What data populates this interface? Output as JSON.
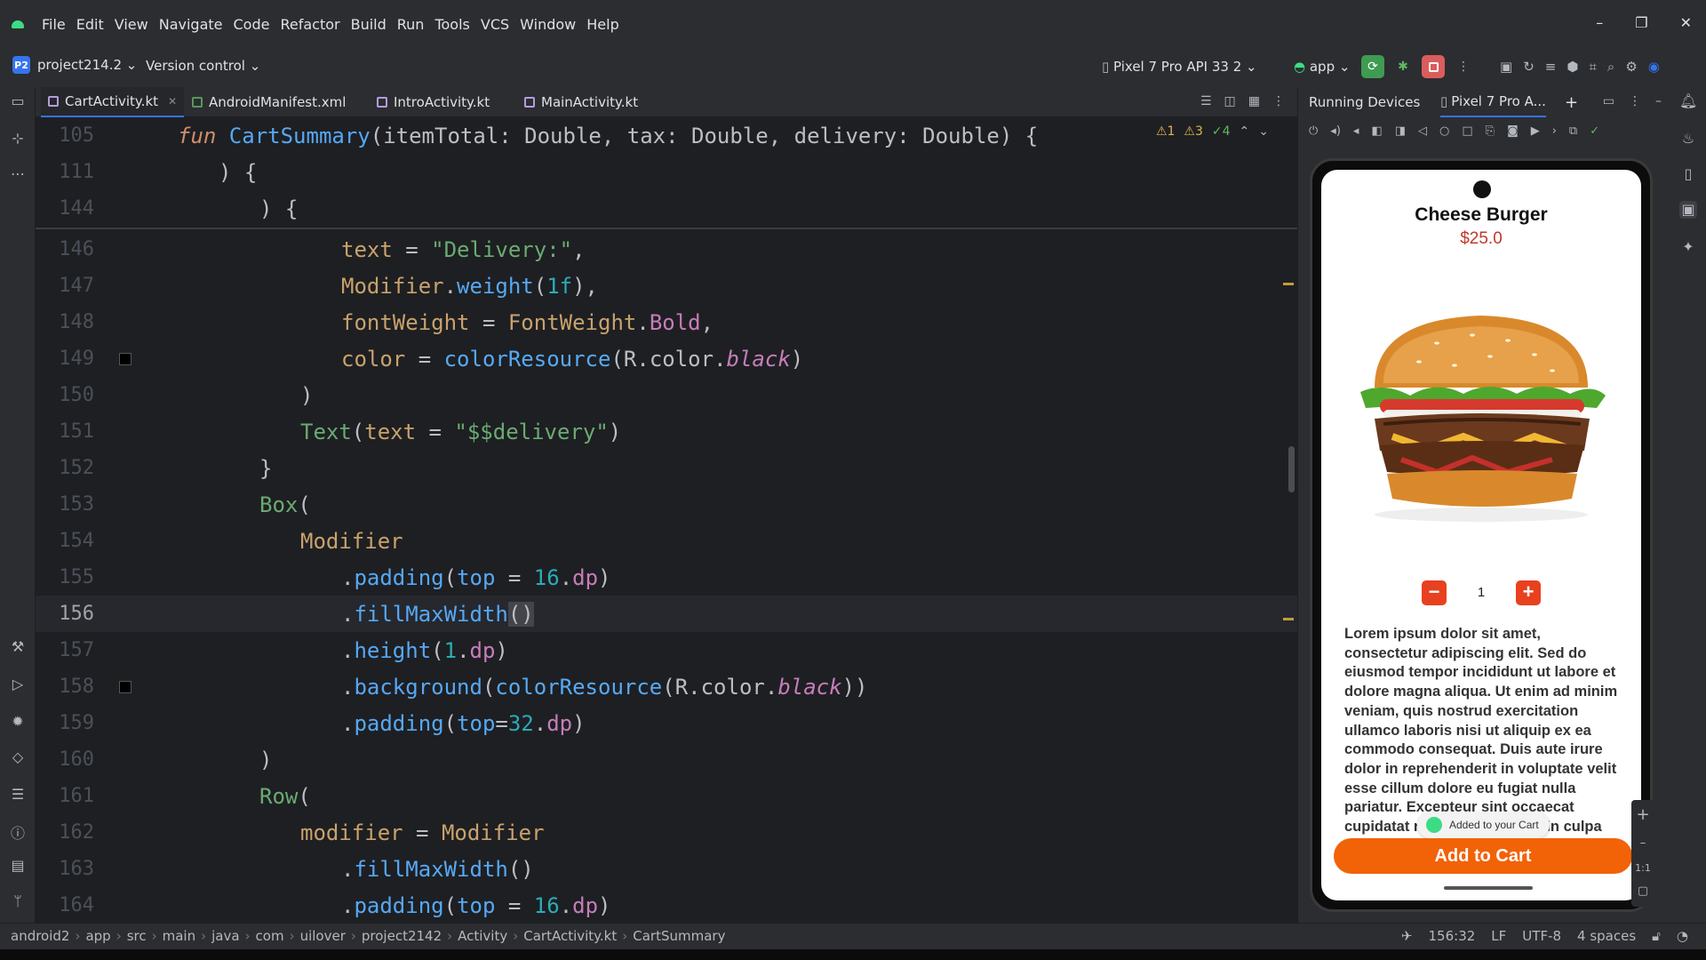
{
  "menubar": {
    "items": [
      "File",
      "Edit",
      "View",
      "Navigate",
      "Code",
      "Refactor",
      "Build",
      "Run",
      "Tools",
      "VCS",
      "Window",
      "Help"
    ],
    "minimize": "–",
    "maximize": "❐",
    "close": "✕"
  },
  "toolbar": {
    "project_badge": "P2",
    "project_name": "project214.2 ⌄",
    "version_control": "Version control ⌄",
    "device": "Pixel 7 Pro API 33 2 ⌄",
    "run_config": "app ⌄"
  },
  "tabs": [
    {
      "label": "CartActivity.kt",
      "close": "✕"
    },
    {
      "label": "AndroidManifest.xml"
    },
    {
      "label": "IntroActivity.kt"
    },
    {
      "label": "MainActivity.kt"
    }
  ],
  "editor_status": {
    "warn1": "⚠1",
    "warn2": "⚠3",
    "ok": "✓4"
  },
  "code": {
    "sticky": [
      {
        "num": "105"
      },
      {
        "num": "111"
      },
      {
        "num": "144"
      }
    ],
    "lines": [
      {
        "num": "146"
      },
      {
        "num": "147"
      },
      {
        "num": "148"
      },
      {
        "num": "149"
      },
      {
        "num": "150"
      },
      {
        "num": "151"
      },
      {
        "num": "152"
      },
      {
        "num": "153"
      },
      {
        "num": "154"
      },
      {
        "num": "155"
      },
      {
        "num": "156"
      },
      {
        "num": "157"
      },
      {
        "num": "158"
      },
      {
        "num": "159"
      },
      {
        "num": "160"
      },
      {
        "num": "161"
      },
      {
        "num": "162"
      },
      {
        "num": "163"
      },
      {
        "num": "164"
      }
    ]
  },
  "panel": {
    "tab_running": "Running Devices",
    "tab_device": "Pixel 7 Pro A...",
    "add": "+"
  },
  "app_screen": {
    "title": "Cheese Burger",
    "price": "$25.0",
    "minus": "−",
    "quantity": "1",
    "plus": "+",
    "description": "Lorem ipsum dolor sit amet, consectetur adipiscing elit. Sed  do eiusmod tempor incididunt ut labore et dolore magna  aliqua. Ut enim ad minim veniam, quis nostrud exercitation  ullamco laboris nisi ut aliquip ex ea commodo consequat. Duis aute irure dolor in reprehenderit in voluptate velit esse  cillum dolore eu fugiat nulla pariatur. Excepteur sint occaecat cupidatat non proident, sunt in culpa qui officia",
    "toast": "Added to your Cart",
    "add_to_cart": "Add to Cart"
  },
  "zoom": {
    "plus": "+",
    "ratio": "1:1"
  },
  "statusbar": {
    "crumbs": [
      "android2",
      "app",
      "src",
      "main",
      "java",
      "com",
      "uilover",
      "project2142",
      "Activity",
      "CartActivity.kt",
      "CartSummary"
    ],
    "position": "156:32",
    "line_sep": "LF",
    "encoding": "UTF-8",
    "indent": "4 spaces"
  },
  "colors": {
    "accent": "#3574f0",
    "orange": "#f26207",
    "red": "#e8411f"
  }
}
